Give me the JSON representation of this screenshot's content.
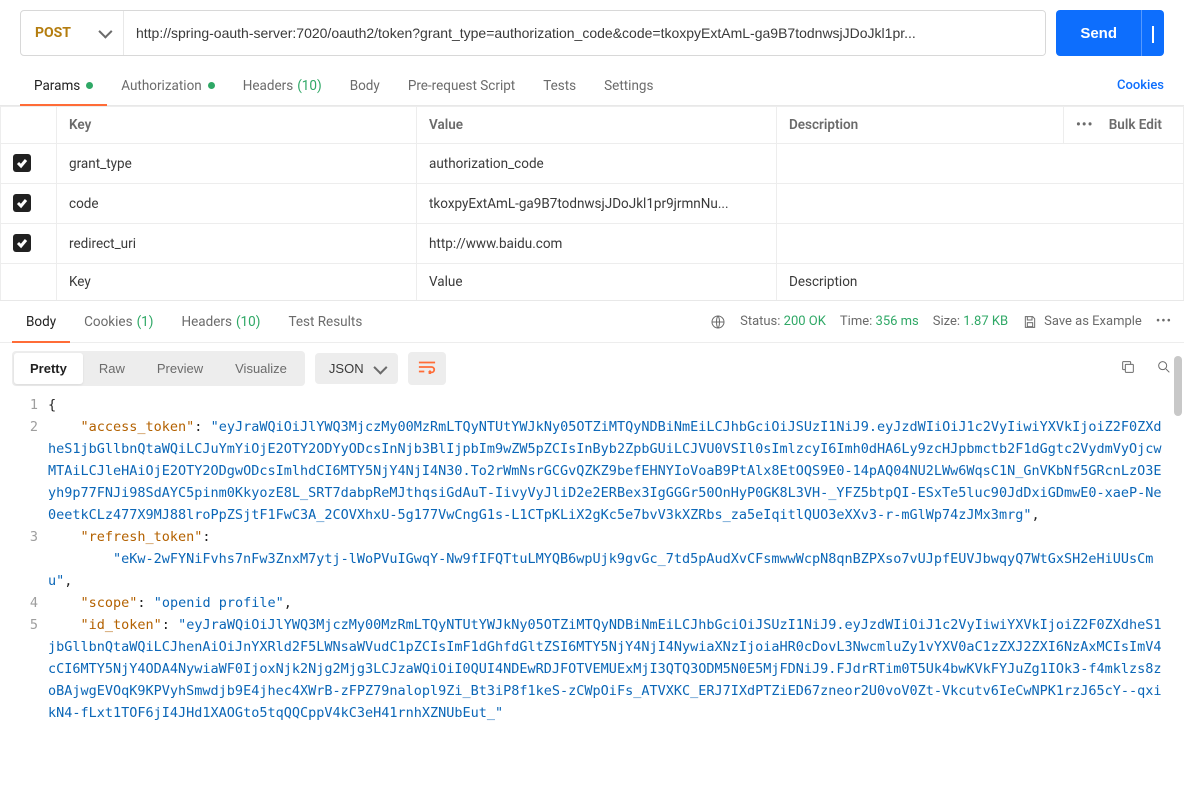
{
  "request": {
    "method": "POST",
    "url": "http://spring-oauth-server:7020/oauth2/token?grant_type=authorization_code&code=tkoxpyExtAmL-ga9B7todnwsjJDoJkl1pr...",
    "send_label": "Send"
  },
  "tabs": {
    "params": "Params",
    "authorization": "Authorization",
    "headers": "Headers",
    "headers_count": "(10)",
    "body": "Body",
    "prerequest": "Pre-request Script",
    "tests": "Tests",
    "settings": "Settings",
    "cookies": "Cookies"
  },
  "params_table": {
    "headers": {
      "key": "Key",
      "value": "Value",
      "desc": "Description",
      "bulk": "Bulk Edit"
    },
    "rows": [
      {
        "key": "grant_type",
        "value": "authorization_code"
      },
      {
        "key": "code",
        "value": "tkoxpyExtAmL-ga9B7todnwsjJDoJkl1pr9jrmnNu..."
      },
      {
        "key": "redirect_uri",
        "value": "http://www.baidu.com"
      }
    ],
    "placeholders": {
      "key": "Key",
      "value": "Value",
      "desc": "Description"
    }
  },
  "resp_tabs": {
    "body": "Body",
    "cookies": "Cookies",
    "cookies_count": "(1)",
    "headers": "Headers",
    "headers_count": "(10)",
    "tests": "Test Results"
  },
  "resp_meta": {
    "status_label": "Status:",
    "status_value": "200 OK",
    "time_label": "Time:",
    "time_value": "356 ms",
    "size_label": "Size:",
    "size_value": "1.87 KB",
    "save": "Save as Example"
  },
  "view": {
    "pretty": "Pretty",
    "raw": "Raw",
    "preview": "Preview",
    "visualize": "Visualize",
    "lang": "JSON"
  },
  "json_body": {
    "access_token": "eyJraWQiOiJlYWQ3MjczMy00MzRmLTQyNTUtYWJkNy05OTZiMTQyNDBiNmEiLCJhbGciOiJSUzI1NiJ9.eyJzdWIiOiJ1c2VyIiwiYXVkIjoiZ2F0ZXdheS1jbGllbnQtaWQiLCJuYmYiOjE2OTY2ODYyODcsInNjb3BlIjpbIm9wZW5pZCIsInByb2ZpbGUiLCJVU0VSIl0sImlzcyI6Imh0dHA6Ly9zcHJpbmctb2F1dGgtc2VydmVyOjcwMTAiLCJleHAiOjE2OTY2ODgwODcsImlhdCI6MTY5NjY4NjI4N30.To2rWmNsrGCGvQZKZ9befEHNYIoVoaB9PtAlx8EtOQS9E0-14pAQ04NU2LWw6WqsC1N_GnVKbNf5GRcnLzO3Eyh9p77FNJi98SdAYC5pinm0KkyozE8L_SRT7dabpReMJthqsiGdAuT-IivyVyJliD2e2ERBex3IgGGGr50OnHyP0GK8L3VH-_YFZ5btpQI-ESxTe5luc90JdDxiGDmwE0-xaeP-Ne0eetkCLz477X9MJ88lroPpZSjtF1FwC3A_2COVXhxU-5g177VwCngG1s-L1CTpKLiX2gKc5e7bvV3kXZRbs_za5eIqitlQUO3eXXv3-r-mGlWp74zJMx3mrg",
    "refresh_token": "eKw-2wFYNiFvhs7nFw3ZnxM7ytj-lWoPVuIGwqY-Nw9fIFQTtuLMYQB6wpUjk9gvGc_7td5pAudXvCFsmwwWcpN8qnBZPXso7vUJpfEUVJbwqyQ7WtGxSH2eHiUUsCmu",
    "scope": "openid profile",
    "id_token": "eyJraWQiOiJlYWQ3MjczMy00MzRmLTQyNTUtYWJkNy05OTZiMTQyNDBiNmEiLCJhbGciOiJSUzI1NiJ9.eyJzdWIiOiJ1c2VyIiwiYXVkIjoiZ2F0ZXdheS1jbGllbnQtaWQiLCJhenAiOiJnYXRld2F5LWNsaWVudC1pZCIsImF1dGhfdGltZSI6MTY5NjY4NjI4NywiaXNzIjoiaHR0cDovL3NwcmluZy1vYXV0aC1zZXJ2ZXI6NzAxMCIsImV4cCI6MTY5NjY4ODA4NywiaWF0IjoxNjk2Njg2Mjg3LCJzaWQiOiI0QUI4NDEwRDJFOTVEMUExMjI3QTQ3ODM5N0E5MjFDNiJ9.FJdrRTim0T5Uk4bwKVkFYJuZg1IOk3-f4mklzs8zoBAjwgEVOqK9KPVyhSmwdjb9E4jhec4XWrB-zFPZ79nalopl9Zi_Bt3iP8f1keS-zCWpOiFs_ATVXKC_ERJ7IXdPTZiED67zneor2U0voV0Zt-Vkcutv6IeCwNPK1rzJ65cY--qxikN4-fLxt1TOF6jI4JHd1XAOGto5tqQQCppV4kC3eH41rnhXZNUbEut_"
  }
}
